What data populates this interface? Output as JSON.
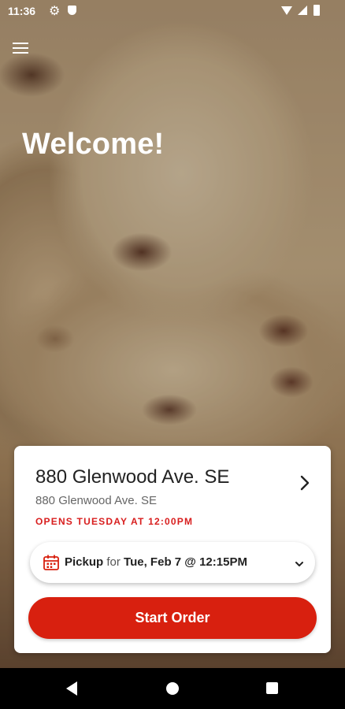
{
  "status_bar": {
    "time": "11:36",
    "icons": [
      "gear-icon",
      "shield-icon",
      "wifi-icon",
      "cellular-icon",
      "battery-icon"
    ]
  },
  "header": {
    "menu_icon": "hamburger-menu-icon",
    "welcome": "Welcome!"
  },
  "location_card": {
    "name": "880 Glenwood Ave. SE",
    "address": "880 Glenwood Ave. SE",
    "hours": "OPENS TUESDAY AT 12:00PM",
    "chevron_icon": "chevron-right-icon"
  },
  "pickup": {
    "icon": "calendar-icon",
    "mode": "Pickup",
    "for_text": "for",
    "time": "Tue, Feb 7 @ 12:15PM",
    "caret_icon": "chevron-down-icon"
  },
  "start_order": {
    "label": "Start Order"
  },
  "colors": {
    "accent": "#d8200f",
    "hours_text": "#d81e1e"
  },
  "nav_bar": {
    "icons": [
      "back-icon",
      "home-icon",
      "recents-icon"
    ]
  }
}
